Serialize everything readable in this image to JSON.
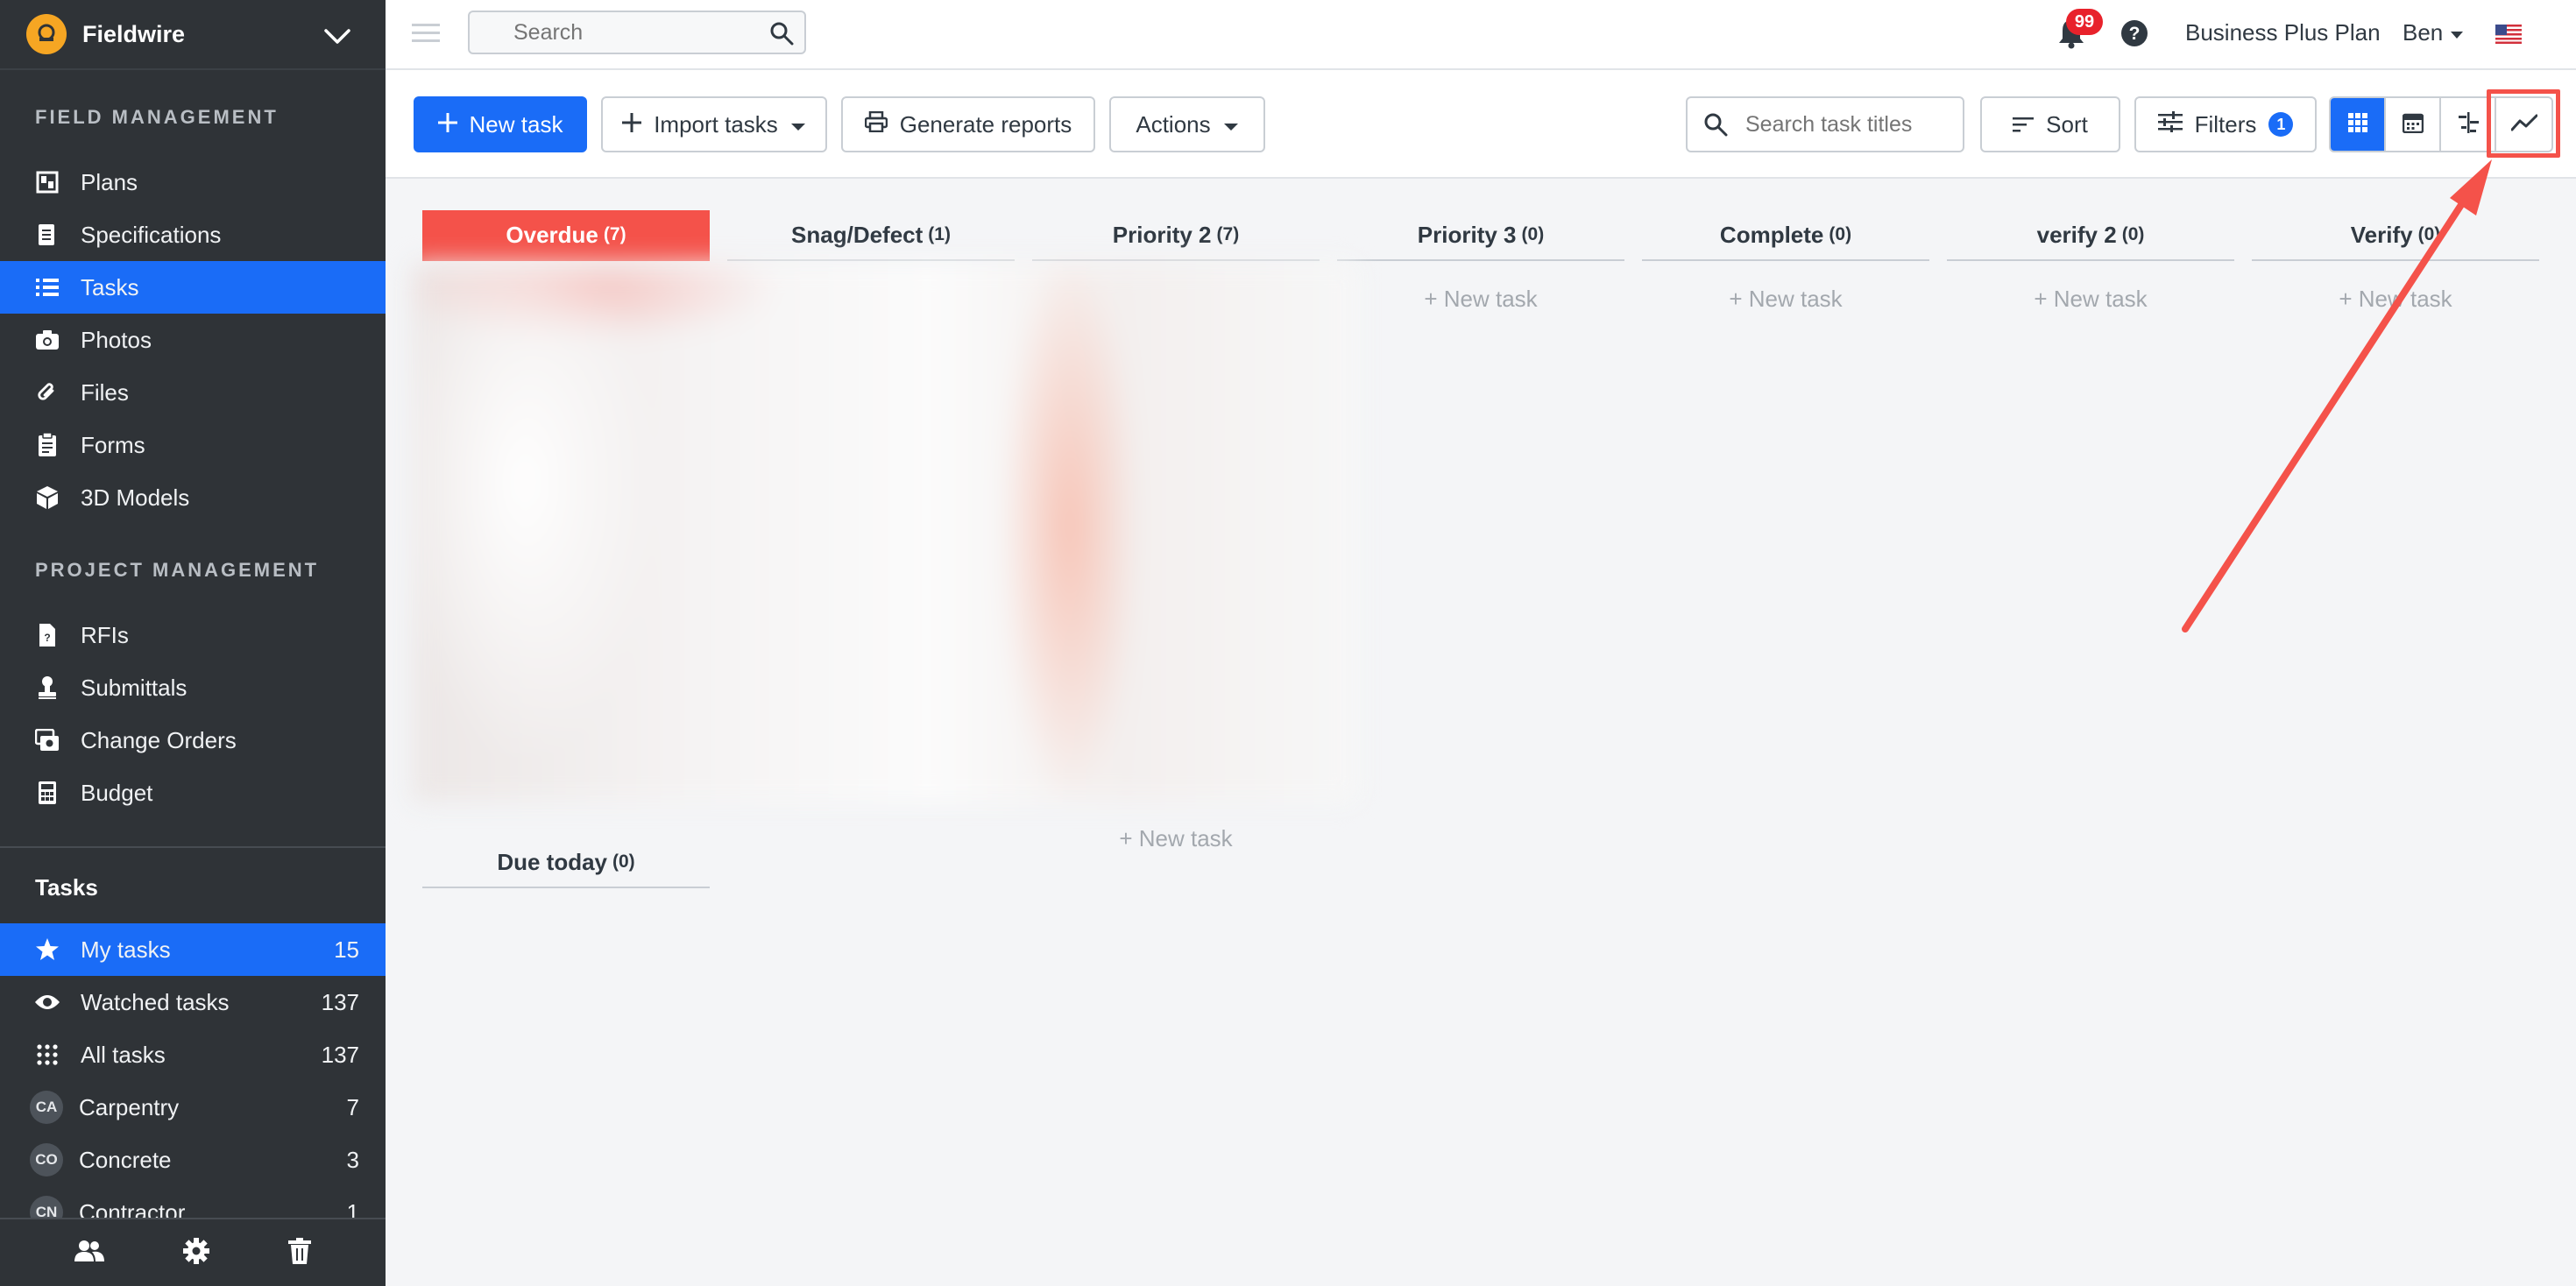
{
  "brand": {
    "name": "Fieldwire"
  },
  "sidebar": {
    "field_management_label": "FIELD MANAGEMENT",
    "field_items": [
      {
        "label": "Plans",
        "icon": "plans-icon"
      },
      {
        "label": "Specifications",
        "icon": "specifications-icon"
      },
      {
        "label": "Tasks",
        "icon": "tasks-icon",
        "active": true
      },
      {
        "label": "Photos",
        "icon": "camera-icon"
      },
      {
        "label": "Files",
        "icon": "paperclip-icon"
      },
      {
        "label": "Forms",
        "icon": "clipboard-icon"
      },
      {
        "label": "3D Models",
        "icon": "cube-icon"
      }
    ],
    "project_management_label": "PROJECT MANAGEMENT",
    "project_items": [
      {
        "label": "RFIs",
        "icon": "rfi-document-icon"
      },
      {
        "label": "Submittals",
        "icon": "stamp-icon"
      },
      {
        "label": "Change Orders",
        "icon": "change-orders-icon"
      },
      {
        "label": "Budget",
        "icon": "calculator-icon"
      }
    ],
    "tasks_title": "Tasks",
    "task_filters": [
      {
        "label": "My tasks",
        "count": "15",
        "icon": "star-icon",
        "active": true
      },
      {
        "label": "Watched tasks",
        "count": "137",
        "icon": "eye-icon"
      },
      {
        "label": "All tasks",
        "count": "137",
        "icon": "grid-dots-icon"
      },
      {
        "label": "Carpentry",
        "count": "7",
        "avatar": "CA"
      },
      {
        "label": "Concrete",
        "count": "3",
        "avatar": "CO"
      },
      {
        "label": "Contractor",
        "count": "1",
        "avatar": "CN"
      }
    ]
  },
  "topbar": {
    "search_placeholder": "Search",
    "notification_count": "99",
    "plan_label": "Business Plus Plan",
    "user_name": "Ben"
  },
  "toolbar": {
    "new_task": "New task",
    "import_tasks": "Import tasks",
    "generate_reports": "Generate reports",
    "actions": "Actions",
    "task_search_placeholder": "Search task titles",
    "sort": "Sort",
    "filters": "Filters",
    "filters_count": "1"
  },
  "board": {
    "columns": [
      {
        "title": "Overdue",
        "count": "(7)"
      },
      {
        "title": "Snag/Defect",
        "count": "(1)"
      },
      {
        "title": "Priority 2",
        "count": "(7)"
      },
      {
        "title": "Priority 3",
        "count": "(0)"
      },
      {
        "title": "Complete",
        "count": "(0)"
      },
      {
        "title": "verify 2",
        "count": "(0)"
      },
      {
        "title": "Verify",
        "count": "(0)"
      }
    ],
    "new_task_label": "+ New task",
    "due_today": {
      "title": "Due today",
      "count": "(0)"
    }
  },
  "colors": {
    "accent": "#1a6cf7",
    "overdue": "#f4524a",
    "sidebar_bg": "#2f3337",
    "annotation": "#f4524a"
  }
}
